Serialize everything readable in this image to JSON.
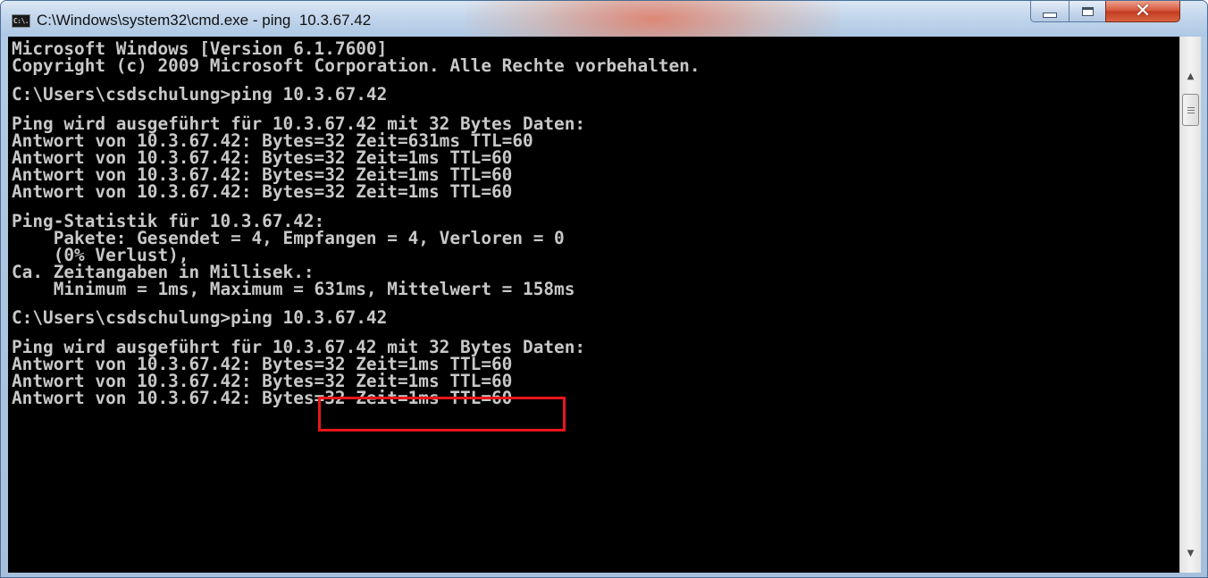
{
  "window": {
    "title": "C:\\Windows\\system32\\cmd.exe - ping  10.3.67.42",
    "icon_label": "C:\\.",
    "icon": "cmd-console-icon",
    "controls": {
      "minimize_icon": "minimize-icon",
      "maximize_icon": "maximize-icon",
      "close_icon": "close-icon",
      "close_glyph": "✕"
    }
  },
  "console": {
    "background": "#000000",
    "text_color": "#c8c8c8",
    "blocks": [
      {
        "lines": [
          "Microsoft Windows [Version 6.1.7600]",
          "Copyright (c) 2009 Microsoft Corporation. Alle Rechte vorbehalten."
        ]
      },
      {
        "lines": [
          "C:\\Users\\csdschulung>ping 10.3.67.42"
        ]
      },
      {
        "lines": [
          "Ping wird ausgeführt für 10.3.67.42 mit 32 Bytes Daten:",
          "Antwort von 10.3.67.42: Bytes=32 Zeit=631ms TTL=60",
          "Antwort von 10.3.67.42: Bytes=32 Zeit=1ms TTL=60",
          "Antwort von 10.3.67.42: Bytes=32 Zeit=1ms TTL=60",
          "Antwort von 10.3.67.42: Bytes=32 Zeit=1ms TTL=60"
        ]
      },
      {
        "lines": [
          "Ping-Statistik für 10.3.67.42:",
          "    Pakete: Gesendet = 4, Empfangen = 4, Verloren = 0",
          "    (0% Verlust),",
          "Ca. Zeitangaben in Millisek.:",
          "    Minimum = 1ms, Maximum = 631ms, Mittelwert = 158ms"
        ]
      },
      {
        "lines": [
          "C:\\Users\\csdschulung>ping 10.3.67.42"
        ]
      },
      {
        "lines": [
          "Ping wird ausgeführt für 10.3.67.42 mit 32 Bytes Daten:",
          "Antwort von 10.3.67.42: Bytes=32 Zeit=1ms TTL=60",
          "Antwort von 10.3.67.42: Bytes=32 Zeit=1ms TTL=60",
          "Antwort von 10.3.67.42: Bytes=32 Zeit=1ms TTL=60"
        ]
      }
    ]
  },
  "annotation": {
    "highlight_color": "#e8161c",
    "highlighted_text": "ping 10.3.67.42"
  },
  "scrollbar": {
    "up_arrow": "▲",
    "down_arrow": "▼",
    "up_icon": "scroll-up-arrow-icon",
    "down_icon": "scroll-down-arrow-icon"
  }
}
